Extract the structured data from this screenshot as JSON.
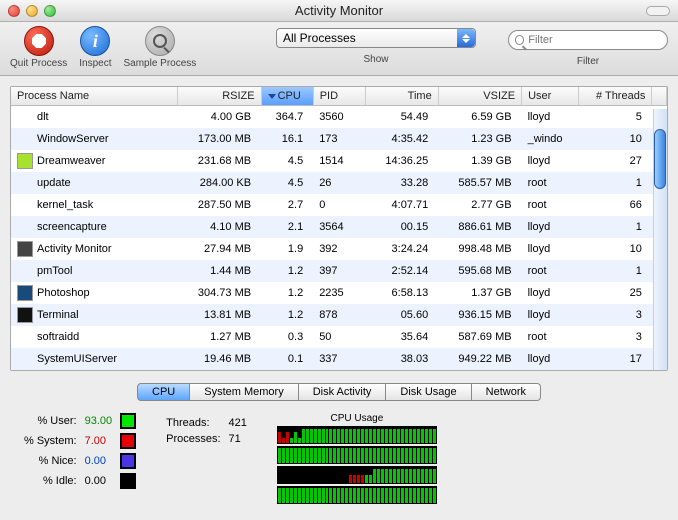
{
  "window": {
    "title": "Activity Monitor"
  },
  "toolbar": {
    "quit_label": "Quit Process",
    "inspect_label": "Inspect",
    "sample_label": "Sample Process",
    "show_label": "Show",
    "filter_label": "Filter",
    "dropdown_value": "All Processes",
    "search_placeholder": "Filter"
  },
  "columns": {
    "name": "Process Name",
    "rsize": "RSIZE",
    "cpu": "CPU",
    "pid": "PID",
    "time": "Time",
    "vsize": "VSIZE",
    "user": "User",
    "threads": "# Threads"
  },
  "rows": [
    {
      "icon": "none",
      "name": "dlt",
      "rsize": "4.00 GB",
      "cpu": "364.7",
      "pid": "3560",
      "time": "54.49",
      "vsize": "6.59 GB",
      "user": "lloyd",
      "threads": "5"
    },
    {
      "icon": "none",
      "name": "WindowServer",
      "rsize": "173.00 MB",
      "cpu": "16.1",
      "pid": "173",
      "time": "4:35.42",
      "vsize": "1.23 GB",
      "user": "_windo",
      "threads": "10"
    },
    {
      "icon": "dw",
      "name": "Dreamweaver",
      "rsize": "231.68 MB",
      "cpu": "4.5",
      "pid": "1514",
      "time": "14:36.25",
      "vsize": "1.39 GB",
      "user": "lloyd",
      "threads": "27"
    },
    {
      "icon": "none",
      "name": "update",
      "rsize": "284.00 KB",
      "cpu": "4.5",
      "pid": "26",
      "time": "33.28",
      "vsize": "585.57 MB",
      "user": "root",
      "threads": "1"
    },
    {
      "icon": "none",
      "name": "kernel_task",
      "rsize": "287.50 MB",
      "cpu": "2.7",
      "pid": "0",
      "time": "4:07.71",
      "vsize": "2.77 GB",
      "user": "root",
      "threads": "66"
    },
    {
      "icon": "none",
      "name": "screencapture",
      "rsize": "4.10 MB",
      "cpu": "2.1",
      "pid": "3564",
      "time": "00.15",
      "vsize": "886.61 MB",
      "user": "lloyd",
      "threads": "1"
    },
    {
      "icon": "am",
      "name": "Activity Monitor",
      "rsize": "27.94 MB",
      "cpu": "1.9",
      "pid": "392",
      "time": "3:24.24",
      "vsize": "998.48 MB",
      "user": "lloyd",
      "threads": "10"
    },
    {
      "icon": "none",
      "name": "pmTool",
      "rsize": "1.44 MB",
      "cpu": "1.2",
      "pid": "397",
      "time": "2:52.14",
      "vsize": "595.68 MB",
      "user": "root",
      "threads": "1"
    },
    {
      "icon": "ps",
      "name": "Photoshop",
      "rsize": "304.73 MB",
      "cpu": "1.2",
      "pid": "2235",
      "time": "6:58.13",
      "vsize": "1.37 GB",
      "user": "lloyd",
      "threads": "25"
    },
    {
      "icon": "tm",
      "name": "Terminal",
      "rsize": "13.81 MB",
      "cpu": "1.2",
      "pid": "878",
      "time": "05.60",
      "vsize": "936.15 MB",
      "user": "lloyd",
      "threads": "3"
    },
    {
      "icon": "none",
      "name": "softraidd",
      "rsize": "1.27 MB",
      "cpu": "0.3",
      "pid": "50",
      "time": "35.64",
      "vsize": "587.69 MB",
      "user": "root",
      "threads": "3"
    },
    {
      "icon": "none",
      "name": "SystemUIServer",
      "rsize": "19.46 MB",
      "cpu": "0.1",
      "pid": "337",
      "time": "38.03",
      "vsize": "949.22 MB",
      "user": "lloyd",
      "threads": "17"
    }
  ],
  "tabs": [
    "CPU",
    "System Memory",
    "Disk Activity",
    "Disk Usage",
    "Network"
  ],
  "cpu_stats": {
    "user_label": "% User:",
    "user_val": "93.00",
    "system_label": "% System:",
    "system_val": "7.00",
    "nice_label": "% Nice:",
    "nice_val": "0.00",
    "idle_label": "% Idle:",
    "idle_val": "0.00",
    "threads_label": "Threads:",
    "threads_val": "421",
    "procs_label": "Processes:",
    "procs_val": "71",
    "graph_label": "CPU Usage"
  }
}
